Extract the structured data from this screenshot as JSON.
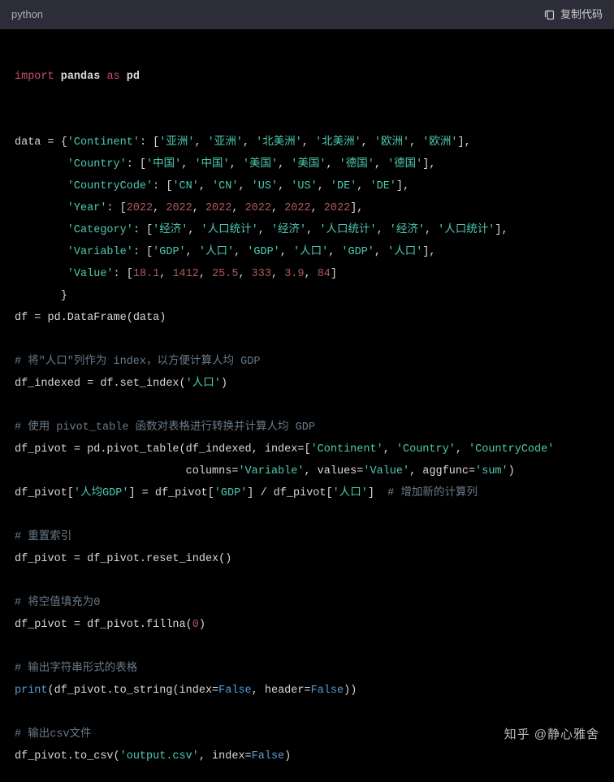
{
  "header": {
    "lang": "python",
    "copy": "复制代码"
  },
  "watermark": "知乎 @静心雅舍",
  "code": {
    "l1_import": "import",
    "l1_pandas": "pandas",
    "l1_as": "as",
    "l1_pd": "pd",
    "l2_data": "data = {",
    "l2_k1": "'Continent'",
    "l2_v1a": "'亚洲'",
    "l2_v1b": "'亚洲'",
    "l2_v1c": "'北美洲'",
    "l2_v1d": "'北美洲'",
    "l2_v1e": "'欧洲'",
    "l2_v1f": "'欧洲'",
    "l3_k": "'Country'",
    "l3_a": "'中国'",
    "l3_b": "'中国'",
    "l3_c": "'美国'",
    "l3_d": "'美国'",
    "l3_e": "'德国'",
    "l3_f": "'德国'",
    "l4_k": "'CountryCode'",
    "l4_a": "'CN'",
    "l4_b": "'CN'",
    "l4_c": "'US'",
    "l4_d": "'US'",
    "l4_e": "'DE'",
    "l4_f": "'DE'",
    "l5_k": "'Year'",
    "l5_n": "2022",
    "l6_k": "'Category'",
    "l6_a": "'经济'",
    "l6_b": "'人口统计'",
    "l7_k": "'Variable'",
    "l7_a": "'GDP'",
    "l7_b": "'人口'",
    "l8_k": "'Value'",
    "l8_a": "18.1",
    "l8_b": "1412",
    "l8_c": "25.5",
    "l8_d": "333",
    "l8_e": "3.9",
    "l8_f": "84",
    "l9_close": "       }",
    "l10": "df = pd.DataFrame(data)",
    "c1": "# 将\"人口\"列作为 index，以方便计算人均 GDP",
    "l11a": "df_indexed = df.set_index(",
    "l11b": "'人口'",
    "l11c": ")",
    "c2": "# 使用 pivot_table 函数对表格进行转换并计算人均 GDP",
    "l12a": "df_pivot = pd.pivot_table(df_indexed, index=[",
    "l12b": "'Continent'",
    "l12c": "'Country'",
    "l12d": "'CountryCode'",
    "l13a": "                          columns=",
    "l13b": "'Variable'",
    "l13c": ", values=",
    "l13d": "'Value'",
    "l13e": ", aggfunc=",
    "l13f": "'sum'",
    "l13g": ")",
    "l14a": "df_pivot[",
    "l14b": "'人均GDP'",
    "l14c": "] = df_pivot[",
    "l14d": "'GDP'",
    "l14e": "] / df_pivot[",
    "l14f": "'人口'",
    "l14g": "]  ",
    "l14h": "# 增加新的计算列",
    "c3": "# 重置索引",
    "l15": "df_pivot = df_pivot.reset_index()",
    "c4": "# 将空值填充为0",
    "l16a": "df_pivot = df_pivot.fillna(",
    "l16b": "0",
    "l16c": ")",
    "c5": "# 输出字符串形式的表格",
    "l17a": "print",
    "l17b": "(df_pivot.to_string(index=",
    "l17c": "False",
    "l17d": ", header=",
    "l17e": "False",
    "l17f": "))",
    "c6": "# 输出csv文件",
    "l18a": "df_pivot.to_csv(",
    "l18b": "'output.csv'",
    "l18c": ", index=",
    "l18d": "False",
    "l18e": ")"
  }
}
